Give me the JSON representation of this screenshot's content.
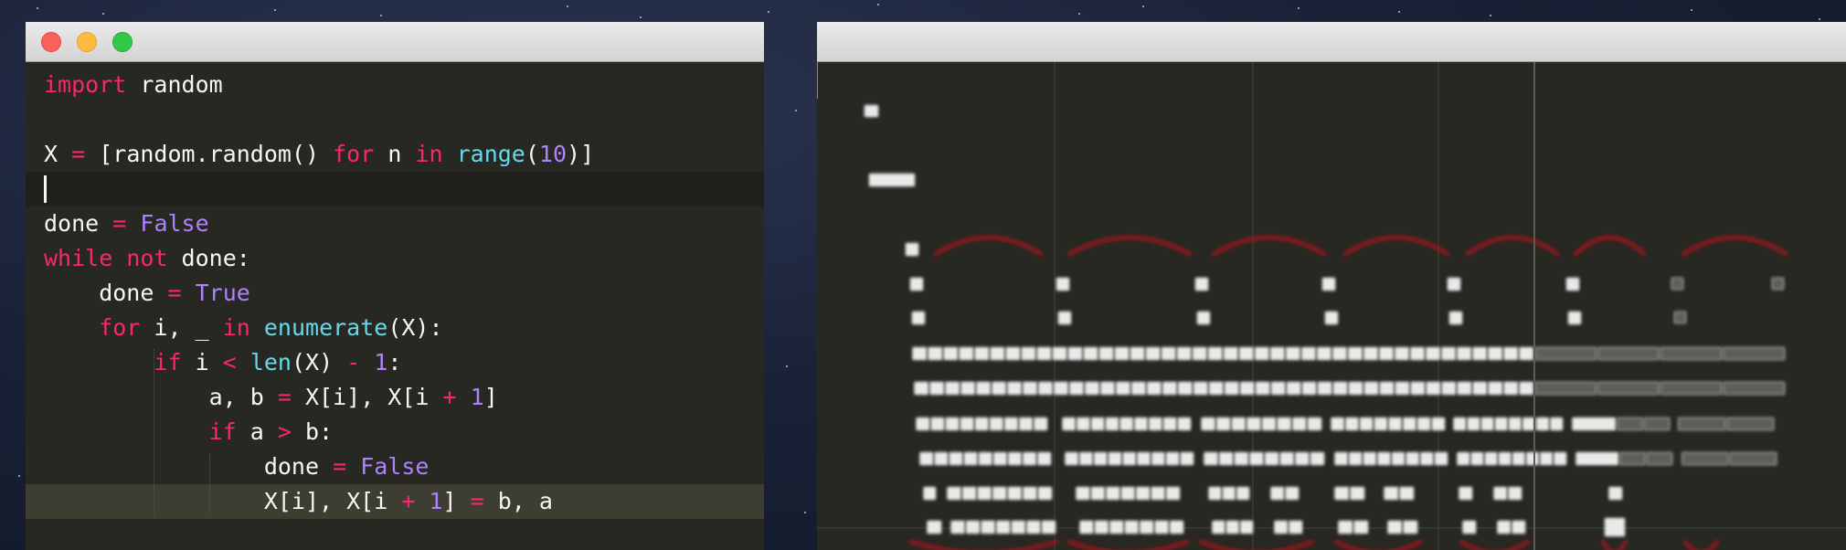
{
  "editor": {
    "lines": [
      [
        {
          "t": "import",
          "c": "kw"
        },
        {
          "t": " random",
          "c": ""
        }
      ],
      [],
      [
        {
          "t": "X ",
          "c": ""
        },
        {
          "t": "=",
          "c": "op"
        },
        {
          "t": " [random.random() ",
          "c": ""
        },
        {
          "t": "for",
          "c": "kw"
        },
        {
          "t": " n ",
          "c": ""
        },
        {
          "t": "in",
          "c": "kw"
        },
        {
          "t": " ",
          "c": ""
        },
        {
          "t": "range",
          "c": "fn"
        },
        {
          "t": "(",
          "c": ""
        },
        {
          "t": "10",
          "c": "num"
        },
        {
          "t": ")]",
          "c": ""
        }
      ],
      [],
      [
        {
          "t": "done ",
          "c": ""
        },
        {
          "t": "=",
          "c": "op"
        },
        {
          "t": " ",
          "c": ""
        },
        {
          "t": "False",
          "c": "const"
        }
      ],
      [
        {
          "t": "while",
          "c": "kw"
        },
        {
          "t": " ",
          "c": ""
        },
        {
          "t": "not",
          "c": "kw"
        },
        {
          "t": " done:",
          "c": ""
        }
      ],
      [
        {
          "t": "    done ",
          "c": ""
        },
        {
          "t": "=",
          "c": "op"
        },
        {
          "t": " ",
          "c": ""
        },
        {
          "t": "True",
          "c": "const"
        }
      ],
      [
        {
          "t": "    ",
          "c": ""
        },
        {
          "t": "for",
          "c": "kw"
        },
        {
          "t": " i, _ ",
          "c": ""
        },
        {
          "t": "in",
          "c": "kw"
        },
        {
          "t": " ",
          "c": ""
        },
        {
          "t": "enumerate",
          "c": "fn"
        },
        {
          "t": "(X):",
          "c": ""
        }
      ],
      [
        {
          "t": "        ",
          "c": ""
        },
        {
          "t": "if",
          "c": "kw"
        },
        {
          "t": " i ",
          "c": ""
        },
        {
          "t": "<",
          "c": "op"
        },
        {
          "t": " ",
          "c": ""
        },
        {
          "t": "len",
          "c": "fn"
        },
        {
          "t": "(X) ",
          "c": ""
        },
        {
          "t": "-",
          "c": "op"
        },
        {
          "t": " ",
          "c": ""
        },
        {
          "t": "1",
          "c": "num"
        },
        {
          "t": ":",
          "c": ""
        }
      ],
      [
        {
          "t": "            a, b ",
          "c": ""
        },
        {
          "t": "=",
          "c": "op"
        },
        {
          "t": " X[i], X[i ",
          "c": ""
        },
        {
          "t": "+",
          "c": "op"
        },
        {
          "t": " ",
          "c": ""
        },
        {
          "t": "1",
          "c": "num"
        },
        {
          "t": "]",
          "c": ""
        }
      ],
      [
        {
          "t": "            ",
          "c": ""
        },
        {
          "t": "if",
          "c": "kw"
        },
        {
          "t": " a ",
          "c": ""
        },
        {
          "t": ">",
          "c": "op"
        },
        {
          "t": " b:",
          "c": ""
        }
      ],
      [
        {
          "t": "                done ",
          "c": ""
        },
        {
          "t": "=",
          "c": "op"
        },
        {
          "t": " ",
          "c": ""
        },
        {
          "t": "False",
          "c": "const"
        }
      ],
      [
        {
          "t": "                X[i], X[i ",
          "c": ""
        },
        {
          "t": "+",
          "c": "op"
        },
        {
          "t": " ",
          "c": ""
        },
        {
          "t": "1",
          "c": "num"
        },
        {
          "t": "] ",
          "c": ""
        },
        {
          "t": "=",
          "c": "op"
        },
        {
          "t": " b, a",
          "c": ""
        }
      ]
    ],
    "cursor_line": 3,
    "highlighted_line": 12
  },
  "colors": {
    "editor_bg": "#272822",
    "keyword": "#f92672",
    "function": "#66d9ef",
    "number": "#ae81ff",
    "text": "#f8f8f2",
    "highlight_line": "#3e3d32",
    "block_color": "#e6e6e6",
    "arc_color": "#b3191d"
  }
}
